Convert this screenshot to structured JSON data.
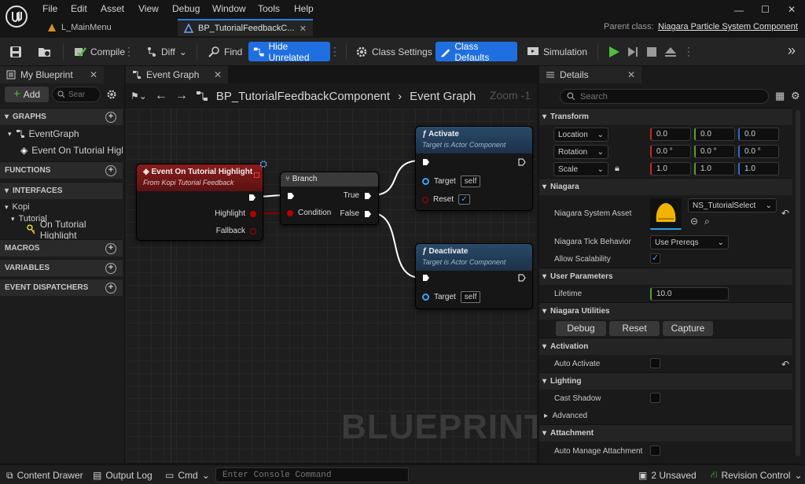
{
  "menu": [
    "File",
    "Edit",
    "Asset",
    "View",
    "Debug",
    "Window",
    "Tools",
    "Help"
  ],
  "tabs": {
    "main_menu": "L_MainMenu",
    "blueprint": "BP_TutorialFeedbackC...",
    "parent_label": "Parent class:",
    "parent_value": "Niagara Particle System Component"
  },
  "toolbar": {
    "compile": "Compile",
    "diff": "Diff",
    "find": "Find",
    "hide_unrelated": "Hide Unrelated",
    "class_settings": "Class Settings",
    "class_defaults": "Class Defaults",
    "simulation": "Simulation"
  },
  "my_blueprint": {
    "tab": "My Blueprint",
    "add": "Add",
    "search_placeholder": "Sear",
    "graphs": "GRAPHS",
    "event_graph": "EventGraph",
    "event_item": "Event On Tutorial Highlight",
    "functions": "FUNCTIONS",
    "interfaces": "INTERFACES",
    "kopi": "Kopi",
    "tutorial": "Tutorial",
    "interface_item": "On Tutorial Highlight",
    "macros": "MACROS",
    "variables": "VARIABLES",
    "dispatchers": "EVENT DISPATCHERS"
  },
  "graph": {
    "tab": "Event Graph",
    "breadcrumb_bp": "BP_TutorialFeedbackComponent",
    "breadcrumb_graph": "Event Graph",
    "zoom": "Zoom -1",
    "watermark": "BLUEPRINT",
    "event_node": {
      "title": "Event On Tutorial Highlight",
      "subtitle": "From Kopi Tutorial Feedback",
      "pin_highlight": "Highlight",
      "pin_fallback": "Fallback"
    },
    "branch_node": {
      "title": "Branch",
      "pin_condition": "Condition",
      "pin_true": "True",
      "pin_false": "False"
    },
    "activate_node": {
      "title": "Activate",
      "subtitle": "Target is Actor Component",
      "target": "Target",
      "self": "self",
      "reset": "Reset"
    },
    "deactivate_node": {
      "title": "Deactivate",
      "subtitle": "Target is Actor Component",
      "target": "Target",
      "self": "self"
    }
  },
  "details": {
    "tab": "Details",
    "search_placeholder": "Search",
    "transform": "Transform",
    "location": "Location",
    "rotation": "Rotation",
    "scale": "Scale",
    "loc": [
      "0.0",
      "0.0",
      "0.0"
    ],
    "rot": [
      "0.0 °",
      "0.0 °",
      "0.0 °"
    ],
    "scl": [
      "1.0",
      "1.0",
      "1.0"
    ],
    "niagara": "Niagara",
    "system_asset": "Niagara System Asset",
    "asset_value": "NS_TutorialSelect",
    "tick_behavior": "Niagara Tick Behavior",
    "tick_value": "Use Prereqs",
    "allow_scalability": "Allow Scalability",
    "user_params": "User Parameters",
    "lifetime": "Lifetime",
    "lifetime_value": "10.0",
    "utilities": "Niagara Utilities",
    "debug": "Debug",
    "reset": "Reset",
    "capture": "Capture",
    "activation": "Activation",
    "auto_activate": "Auto Activate",
    "lighting": "Lighting",
    "cast_shadow": "Cast Shadow",
    "advanced": "Advanced",
    "attachment": "Attachment",
    "auto_manage": "Auto Manage Attachment"
  },
  "status": {
    "content_drawer": "Content Drawer",
    "output_log": "Output Log",
    "cmd": "Cmd",
    "console_placeholder": "Enter Console Command",
    "unsaved": "2 Unsaved",
    "revision": "Revision Control"
  },
  "colors": {
    "accent": "#1f6fe0",
    "event_header": "#8a1c1c",
    "function_header": "#1f3f5c",
    "exec_pin": "#ffffff",
    "bool_pin": "#b30000",
    "object_pin": "#3aa5ff"
  }
}
